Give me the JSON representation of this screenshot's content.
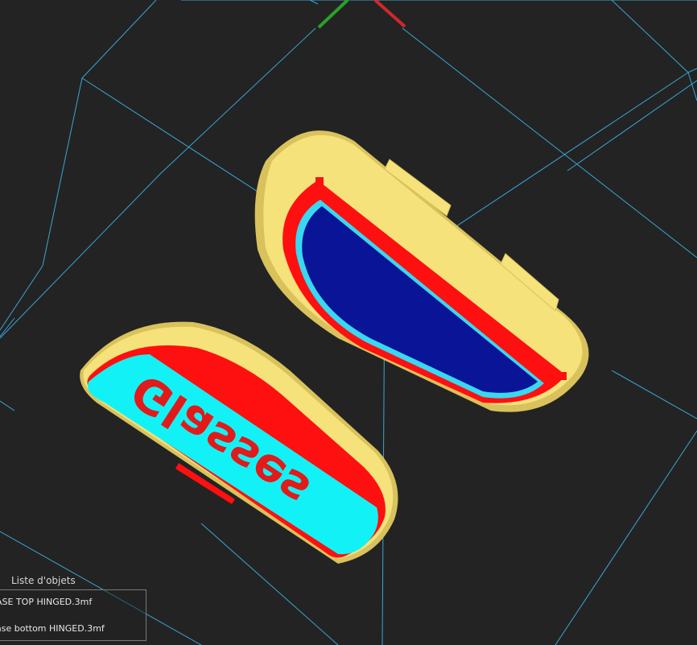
{
  "viewport": {
    "background": "#232323",
    "bed_line_color": "#39a6d6",
    "axis_x_color": "#d0282a",
    "axis_y_color": "#2aa02a",
    "model_colors": {
      "outer_shell": "#f6e27a",
      "outer_shell_shade": "#d9c25c",
      "perimeter": "#ff1010",
      "inner_top": "#0a1496",
      "inner_outline": "#38d8f2",
      "label_plate": "#12f2f6"
    },
    "embossed_text": "Glasses"
  },
  "object_panel": {
    "title": "Liste d'objets",
    "items": [
      "ASE TOP HINGED.3mf",
      "ase bottom HINGED.3mf"
    ]
  }
}
